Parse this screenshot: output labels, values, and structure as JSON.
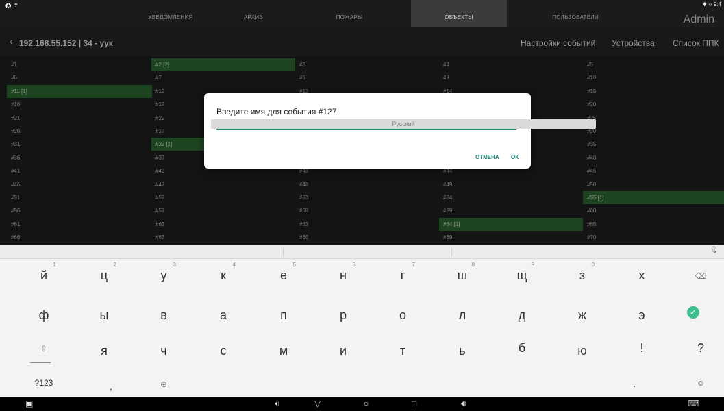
{
  "tabs": [
    "УВЕДОМЛЕНИЯ",
    "АРХИВ",
    "ПОЖАРЫ",
    "ОБЪЕКТЫ",
    "ПОЛЬЗОВАТЕЛИ"
  ],
  "active_tab": "ОБЪЕКТЫ",
  "status": {
    "left_icons": "✪ ⇡",
    "right_icons": "✱ ‹› 9:4",
    "user": "Admin"
  },
  "header": {
    "back_icon": "chevron-left-icon",
    "address": "192.168.55.152 | 34 - уук",
    "actions": [
      "Настройки событий",
      "Устройства",
      "Список ППК"
    ]
  },
  "grid": [
    [
      "#1",
      "#2 [2]",
      "#3",
      "#4",
      "#5"
    ],
    [
      "#6",
      "#7",
      "#8",
      "#9",
      "#10"
    ],
    [
      "#11 [1]",
      "#12",
      "#13",
      "#14",
      "#15"
    ],
    [
      "#16",
      "#17",
      "",
      "",
      "#20"
    ],
    [
      "#21",
      "#22",
      "",
      "",
      "#25"
    ],
    [
      "#26",
      "#27",
      "",
      "",
      "#30"
    ],
    [
      "#31",
      "#32 [1]",
      "",
      "",
      "#35"
    ],
    [
      "#36",
      "#37",
      "",
      "",
      "#40"
    ],
    [
      "#41",
      "#42",
      "#43",
      "#44",
      "#45"
    ],
    [
      "#46",
      "#47",
      "#48",
      "#49",
      "#50"
    ],
    [
      "#51",
      "#52",
      "#53",
      "#54",
      "#55 [1]"
    ],
    [
      "#56",
      "#57",
      "#58",
      "#59",
      "#60"
    ],
    [
      "#61",
      "#62",
      "#63",
      "#64 [1]",
      "#65"
    ],
    [
      "#66",
      "#67",
      "#68",
      "#69",
      "#70"
    ]
  ],
  "dialog": {
    "title": "Введите имя для события #127",
    "input_value": "",
    "cancel": "ОТМЕНА",
    "ok": "ОК"
  },
  "keyboard": {
    "row1": [
      "й",
      "ц",
      "у",
      "к",
      "е",
      "н",
      "г",
      "ш",
      "щ",
      "з",
      "х"
    ],
    "row1_hints": [
      "1",
      "2",
      "3",
      "4",
      "5",
      "6",
      "7",
      "8",
      "9",
      "0",
      ""
    ],
    "row2": [
      "ф",
      "ы",
      "в",
      "а",
      "п",
      "р",
      "о",
      "л",
      "д",
      "ж",
      "э"
    ],
    "row3": [
      "я",
      "ч",
      "с",
      "м",
      "и",
      "т",
      "ь",
      "б",
      "ю",
      "!",
      "?"
    ],
    "mode_key": "?123",
    "comma": ",",
    "period": ".",
    "space_label": "Русский",
    "globe_icon": "globe-icon",
    "emoji_icon": "emoji-icon",
    "backspace_icon": "backspace-icon",
    "enter_icon": "checkmark-icon",
    "shift_icon": "shift-icon"
  },
  "navbar": {
    "screenshot_icon": "screenshot-icon",
    "volume_down_icon": "volume-down-icon",
    "back_icon": "back-triangle-icon",
    "home_icon": "home-circle-icon",
    "recents_icon": "recents-square-icon",
    "volume_up_icon": "volume-up-icon",
    "keyboard_icon": "keyboard-icon"
  }
}
